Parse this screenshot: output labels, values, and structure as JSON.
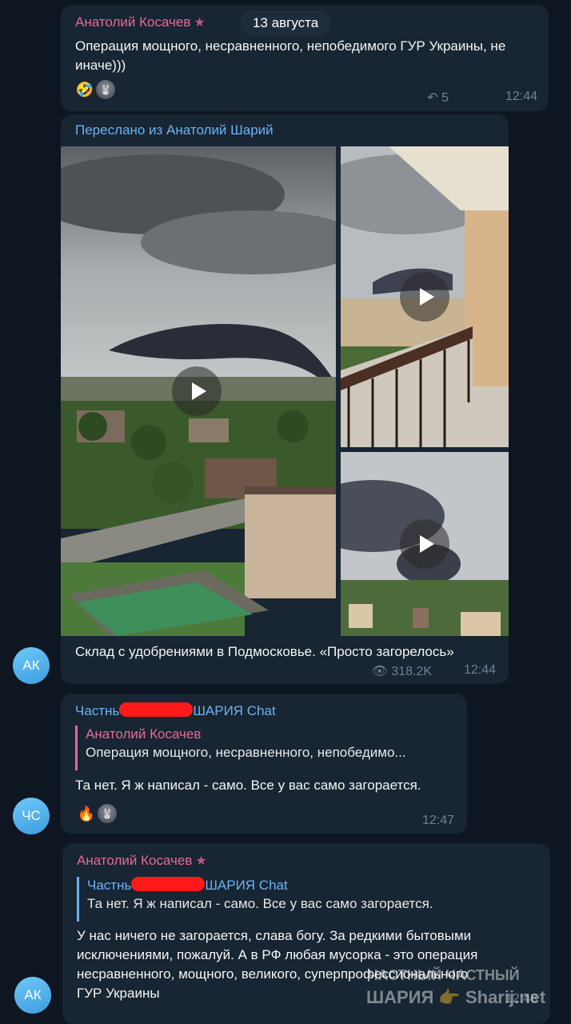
{
  "date_separator": "13 августа",
  "messages": [
    {
      "sender": "Анатолий Косачев",
      "text": "Операция мощного, несравненного, непобедимого ГУР Украины, не иначе)))",
      "reactions": [
        "🤣",
        "user-avatar"
      ],
      "replies": "5",
      "time": "12:44"
    },
    {
      "forwarded_label": "Переслано из Анатолий Шарий",
      "caption": "Склад с удобрениями в Подмосковье. «Просто загорелось»",
      "views": "318.2K",
      "time": "12:44",
      "avatar_initials": "АК"
    },
    {
      "sender_prefix": "Частнь",
      "sender_suffix": "ШАРИЯ Chat",
      "quote_name": "Анатолий Косачев",
      "quote_text": "Операция мощного, несравненного, непобедимо...",
      "text": "Та нет. Я ж написал - само. Все у вас само загорается.",
      "reactions": [
        "🔥",
        "user-avatar"
      ],
      "time": "12:47",
      "avatar_initials": "ЧС"
    },
    {
      "sender": "Анатолий Косачев",
      "quote_name_prefix": "Частнь",
      "quote_name_suffix": "ШАРИЯ Chat",
      "quote_text": "Та нет. Я ж написал - само. Все у вас само загорается.",
      "text_lines": [
        "У нас ничего не загорается, слава богу. За редкими бытовыми",
        "исключениями, пожалуй. А в РФ любая мусорка - это операция",
        "несравненного, мощного, великого, суперпрофессионального",
        "ГУР Украины"
      ],
      "time": "12:48",
      "avatar_initials": "АК"
    }
  ],
  "watermark": {
    "line1": "ЧАСТНЫЙ ЧАСТНЫЙ",
    "line2": "ШАРИЯ",
    "line2b": "Sharij.net"
  },
  "colors": {
    "background": "#0e1621",
    "bubble": "#182533",
    "pink_name": "#e56a96",
    "blue_name": "#6ab3f3",
    "meta": "#6d8294",
    "redaction": "#ff1a1a"
  }
}
